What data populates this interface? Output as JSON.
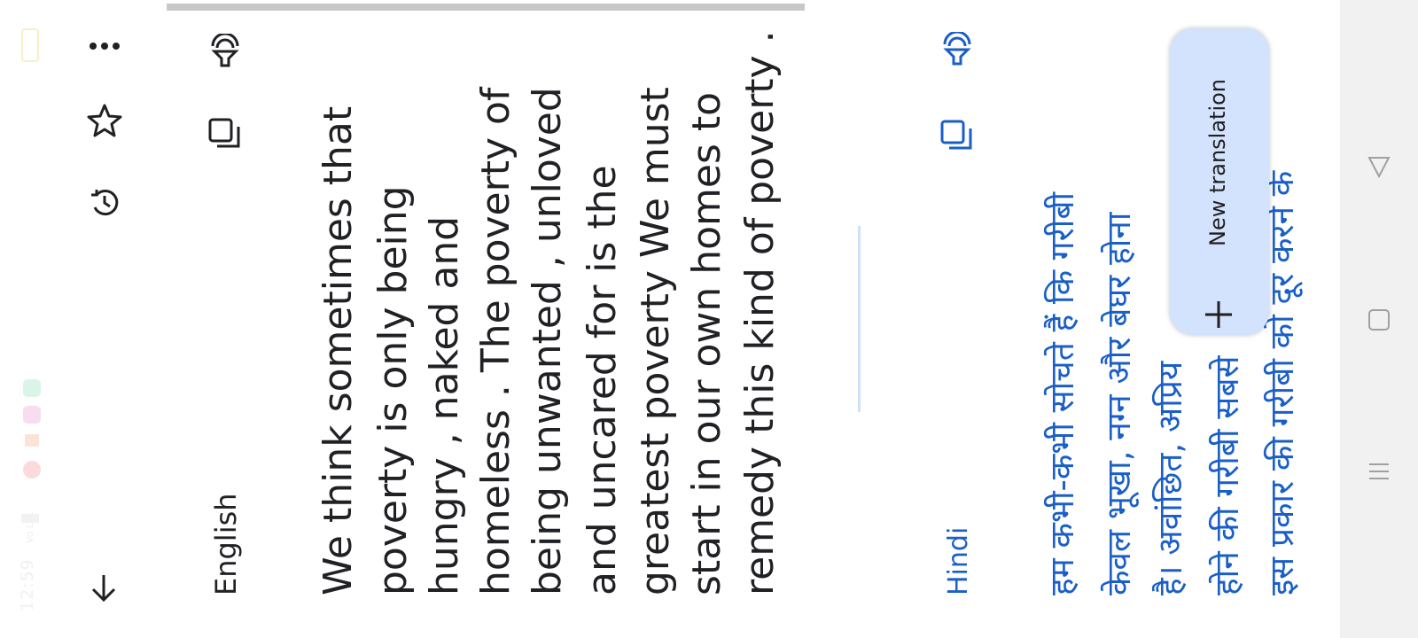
{
  "status_bar": {
    "time": "12:59",
    "network": "Vo LTE",
    "signal": "4G",
    "battery": "60"
  },
  "toolbar": {
    "back_icon": "arrow-down-icon",
    "history_icon": "history-icon",
    "star_icon": "star-outline-icon",
    "more_icon": "more-horizontal-icon"
  },
  "source": {
    "language": "English",
    "lines": [
      "We think sometimes that",
      "poverty is only being",
      "hungry , naked and",
      "homeless . The poverty of",
      "being unwanted , unloved",
      "and uncared for is the",
      "greatest poverty We must",
      "start in our own homes to",
      "remedy this kind of poverty ."
    ]
  },
  "target": {
    "language": "Hindi",
    "lines": [
      "हम कभी-कभी सोचते हैं कि गरीबी",
      "केवल भूखा, नग्न और बेघर होना",
      "है। अवांछित, अप्रिय",
      "होने की गरीबी सबसे",
      "इस प्रकार की गरीबी को दूर करने के"
    ]
  },
  "fab": {
    "label": "New translation",
    "plus": "+"
  },
  "colors": {
    "accent": "#1a5fc7",
    "fab_bg": "#d3e3fd",
    "text": "#202124"
  }
}
